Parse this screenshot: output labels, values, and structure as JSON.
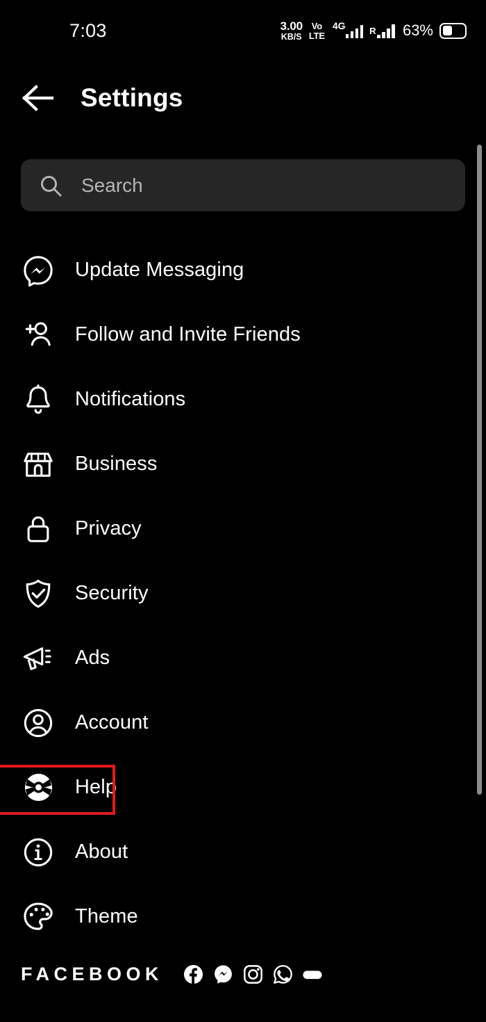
{
  "status_bar": {
    "clock": "7:03",
    "net_speed_value": "3.00",
    "net_speed_unit": "KB/S",
    "volte_line1": "Vo",
    "volte_line2": "LTE",
    "network_type": "4G",
    "roaming_label": "R",
    "battery_percent": "63%",
    "battery_icon": "battery-icon"
  },
  "header": {
    "back_icon": "back-arrow-icon",
    "title": "Settings"
  },
  "search": {
    "icon": "search-icon",
    "placeholder": "Search",
    "value": ""
  },
  "menu": {
    "items": [
      {
        "label": "Update Messaging",
        "icon": "messenger-icon",
        "highlighted": false
      },
      {
        "label": "Follow and Invite Friends",
        "icon": "person-add-icon",
        "highlighted": false
      },
      {
        "label": "Notifications",
        "icon": "bell-icon",
        "highlighted": false
      },
      {
        "label": "Business",
        "icon": "storefront-icon",
        "highlighted": false
      },
      {
        "label": "Privacy",
        "icon": "lock-icon",
        "highlighted": false
      },
      {
        "label": "Security",
        "icon": "shield-check-icon",
        "highlighted": false
      },
      {
        "label": "Ads",
        "icon": "megaphone-icon",
        "highlighted": false
      },
      {
        "label": "Account",
        "icon": "user-circle-icon",
        "highlighted": false
      },
      {
        "label": "Help",
        "icon": "lifebuoy-icon",
        "highlighted": true
      },
      {
        "label": "About",
        "icon": "info-circle-icon",
        "highlighted": false
      },
      {
        "label": "Theme",
        "icon": "palette-icon",
        "highlighted": false
      }
    ]
  },
  "footer": {
    "brand": "FACEBOOK",
    "social_icons": [
      "facebook-icon",
      "messenger-icon",
      "instagram-icon",
      "whatsapp-icon",
      "meta-oculus-icon"
    ]
  },
  "colors": {
    "background": "#000000",
    "text": "#ffffff",
    "search_background": "#262626",
    "placeholder": "#b5b5b5",
    "highlight": "#e01b1b",
    "scrollbar": "#8d8d8d"
  }
}
